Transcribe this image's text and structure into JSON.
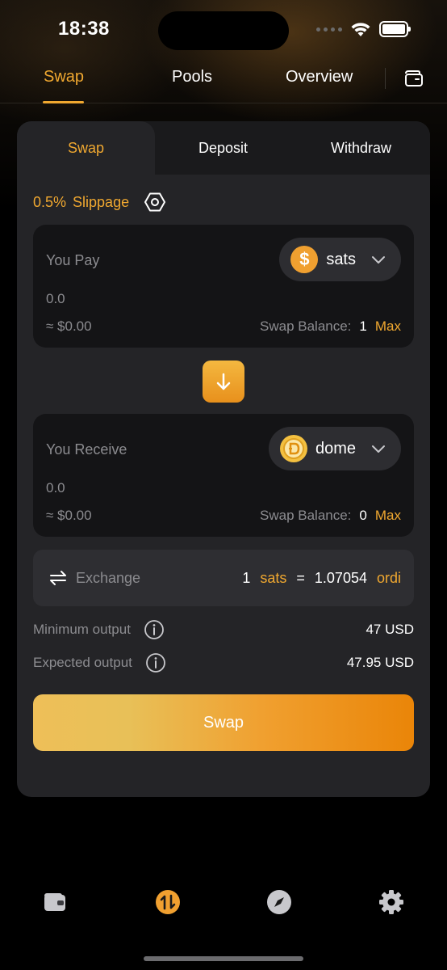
{
  "status_bar": {
    "time": "18:38"
  },
  "top_nav": {
    "tabs": [
      {
        "label": "Swap",
        "active": true
      },
      {
        "label": "Pools",
        "active": false
      },
      {
        "label": "Overview",
        "active": false
      }
    ],
    "wallet_icon": "folder-wallet-icon"
  },
  "card": {
    "subtabs": [
      {
        "label": "Swap",
        "active": true
      },
      {
        "label": "Deposit",
        "active": false
      },
      {
        "label": "Withdraw",
        "active": false
      }
    ],
    "slippage": {
      "value": "0.5%",
      "label": "Slippage",
      "icon": "settings-hex-icon"
    },
    "pay": {
      "label": "You Pay",
      "token": "sats",
      "amount": "0.0",
      "usd": "≈ $0.00",
      "balance_label": "Swap Balance:",
      "balance": "1",
      "max_label": "Max"
    },
    "receive": {
      "label": "You Receive",
      "token": "dome",
      "amount": "0.0",
      "usd": "≈ $0.00",
      "balance_label": "Swap Balance:",
      "balance": "0",
      "max_label": "Max"
    },
    "exchange": {
      "label": "Exchange",
      "left_amount": "1",
      "left_token": "sats",
      "equals": "=",
      "right_amount": "1.07054",
      "right_token": "ordi"
    },
    "minimum_output": {
      "label": "Minimum output",
      "value": "47 USD"
    },
    "expected_output": {
      "label": "Expected output",
      "value": "47.95 USD"
    },
    "swap_button": "Swap"
  },
  "bottom_nav": [
    {
      "icon": "wallet-icon",
      "active": false
    },
    {
      "icon": "swap-icon",
      "active": true
    },
    {
      "icon": "compass-icon",
      "active": false
    },
    {
      "icon": "gear-icon",
      "active": false
    }
  ],
  "colors": {
    "accent": "#f0a830",
    "card": "#242427",
    "panel": "#141416"
  }
}
